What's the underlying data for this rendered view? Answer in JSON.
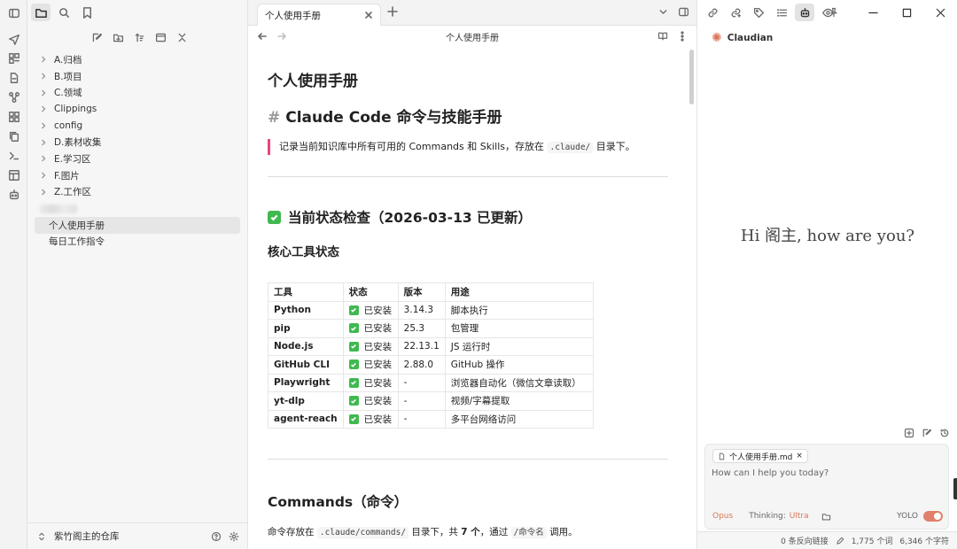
{
  "colors": {
    "accent": "#d97757",
    "check": "#3fb950",
    "quote_bar": "#e9457b"
  },
  "sidebar": {
    "folders": [
      "A.归档",
      "B.项目",
      "C.领域",
      "Clippings",
      "config",
      "D.素材收集",
      "E.学习区",
      "F.图片",
      "Z.工作区"
    ],
    "files": [
      "个人使用手册",
      "每日工作指令"
    ],
    "vault_name": "紫竹阁主的仓库"
  },
  "editor": {
    "tab_title": "个人使用手册",
    "view_title": "个人使用手册",
    "h1": "个人使用手册",
    "h2_hash": "#",
    "h2": "Claude Code 命令与技能手册",
    "quote_pre": "记录当前知识库中所有可用的 Commands 和 Skills，存放在",
    "quote_code": ".claude/",
    "quote_post": "目录下。",
    "status_heading": "当前状态检查（2026-03-13 已更新）",
    "tools_heading": "核心工具状态",
    "table": {
      "headers": [
        "工具",
        "状态",
        "版本",
        "用途"
      ],
      "rows": [
        [
          "Python",
          "已安装",
          "3.14.3",
          "脚本执行"
        ],
        [
          "pip",
          "已安装",
          "25.3",
          "包管理"
        ],
        [
          "Node.js",
          "已安装",
          "22.13.1",
          "JS 运行时"
        ],
        [
          "GitHub CLI",
          "已安装",
          "2.88.0",
          "GitHub 操作"
        ],
        [
          "Playwright",
          "已安装",
          "-",
          "浏览器自动化（微信文章读取）"
        ],
        [
          "yt-dlp",
          "已安装",
          "-",
          "视频/字幕提取"
        ],
        [
          "agent-reach",
          "已安装",
          "-",
          "多平台网络访问"
        ]
      ]
    },
    "commands_heading": "Commands（命令）",
    "cmd_p1": "命令存放在",
    "cmd_code": ".claude/commands/",
    "cmd_p2": "目录下，共",
    "cmd_count": "7 个",
    "cmd_p3": "，通过",
    "cmd_code2": "/命令名",
    "cmd_p4": "调用。"
  },
  "right": {
    "brand": "Claudian",
    "greeting": "Hi 阁主, how are you?",
    "chip_file": "个人使用手册.md",
    "chip_close": "×",
    "prompt_placeholder": "How can I help you today?",
    "model": "Opus",
    "thinking_label": "Thinking:",
    "thinking_level": "Ultra",
    "yolo": "YOLO",
    "status": {
      "backlinks": "0 条反向链接",
      "words": "1,775 个词",
      "chars": "6,346 个字符"
    }
  }
}
